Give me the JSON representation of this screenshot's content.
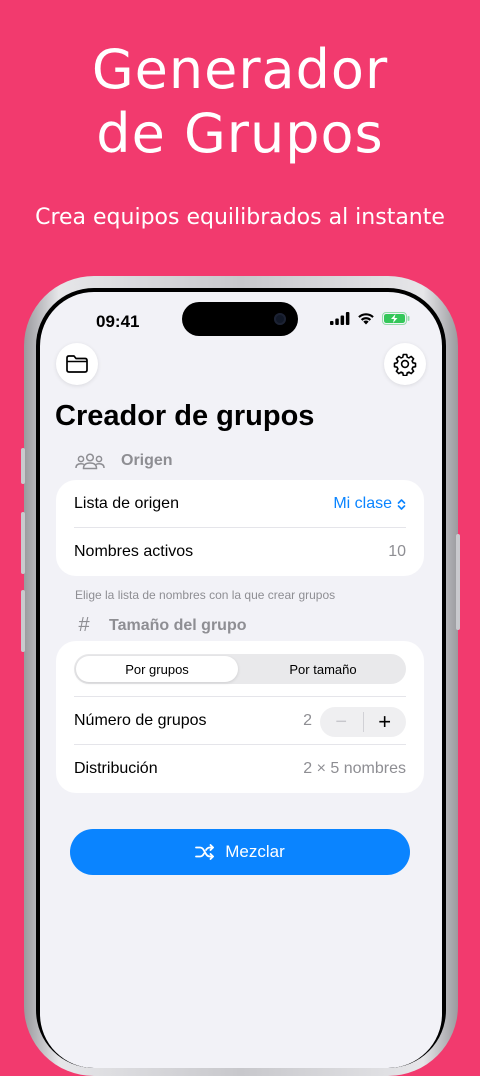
{
  "hero": {
    "title_line1": "Generador",
    "title_line2": "de Grupos",
    "subtitle": "Crea equipos equilibrados al instante"
  },
  "status_bar": {
    "time": "09:41",
    "icons": [
      "signal-icon",
      "wifi-icon",
      "battery-charging-icon"
    ]
  },
  "toolbar": {
    "left_icon": "folder-icon",
    "right_icon": "gear-icon"
  },
  "page": {
    "title": "Creador de grupos"
  },
  "origin_section": {
    "header_icon": "people-icon",
    "header": "Origen",
    "rows": [
      {
        "label": "Lista de origen",
        "value": "Mi clase"
      },
      {
        "label": "Nombres activos",
        "value": "10"
      }
    ],
    "footnote": "Elige la lista de nombres con la que crear grupos"
  },
  "size_section": {
    "header_icon": "hash-icon",
    "header": "Tamaño del grupo",
    "segments": [
      "Por grupos",
      "Por tamaño"
    ],
    "selected_segment": "Por grupos",
    "groups_row": {
      "label": "Número de grupos",
      "value": "2",
      "minus": "−",
      "plus": "+"
    },
    "distribution_row": {
      "label": "Distribución",
      "value": "2 × 5 nombres"
    }
  },
  "action": {
    "icon": "shuffle-icon",
    "label": "Mezclar"
  },
  "colors": {
    "background": "#F23A6E",
    "accent": "#0A84FF",
    "battery": "#34C759"
  }
}
